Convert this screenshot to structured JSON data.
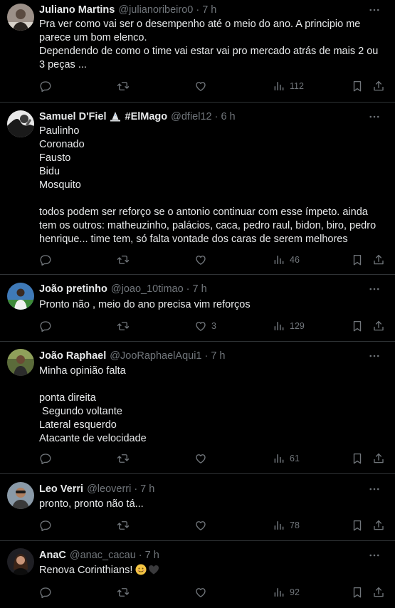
{
  "tweets": [
    {
      "name": "Juliano Martins",
      "handle": "@julianoribeiro0",
      "time": "7 h",
      "text": "Pra ver como vai ser o desempenho até o meio do ano. A principio me parece um bom elenco.\nDependendo de como o time vai estar vai pro mercado atrás de mais 2 ou 3 peças ...",
      "likes": "",
      "views": "112"
    },
    {
      "name": "Samuel D'Fiel",
      "name_suffix": "#ElMago",
      "handle": "@dfiel12",
      "time": "6 h",
      "text": "Paulinho\nCoronado\nFausto\nBidu\nMosquito\n\ntodos podem ser reforço se o antonio continuar com esse ímpeto. ainda tem os outros: matheuzinho, palácios, caca, pedro raul, bidon, biro, pedro henrique... time tem, só falta vontade dos caras de serem melhores",
      "likes": "",
      "views": "46"
    },
    {
      "name": "João pretinho",
      "handle": "@joao_10timao",
      "time": "7 h",
      "text": "Pronto não , meio do ano precisa vim reforços",
      "likes": "3",
      "views": "129"
    },
    {
      "name": "João Raphael",
      "handle": "@JooRaphaelAqui1",
      "time": "7 h",
      "text": "Minha opinião falta\n\nponta direita\n Segundo voltante\nLateral esquerdo\nAtacante de velocidade",
      "likes": "",
      "views": "61"
    },
    {
      "name": "Leo Verri",
      "handle": "@leoverri",
      "time": "7 h",
      "text": "pronto, pronto não tá...",
      "likes": "",
      "views": "78"
    },
    {
      "name": "AnaC",
      "handle": "@anac_cacau",
      "time": "7 h",
      "text": "Renova Corinthians!",
      "likes": "",
      "views": "92"
    }
  ],
  "separator": "·",
  "icons": {
    "reply": "reply-icon",
    "retweet": "retweet-icon",
    "like": "heart-icon",
    "views": "views-chart-icon",
    "bookmark": "bookmark-icon",
    "share": "share-icon",
    "more": "more-dots-icon"
  },
  "colors": {
    "background": "#000000",
    "text": "#e7e9ea",
    "muted": "#71767b",
    "divider": "#2f3336"
  }
}
